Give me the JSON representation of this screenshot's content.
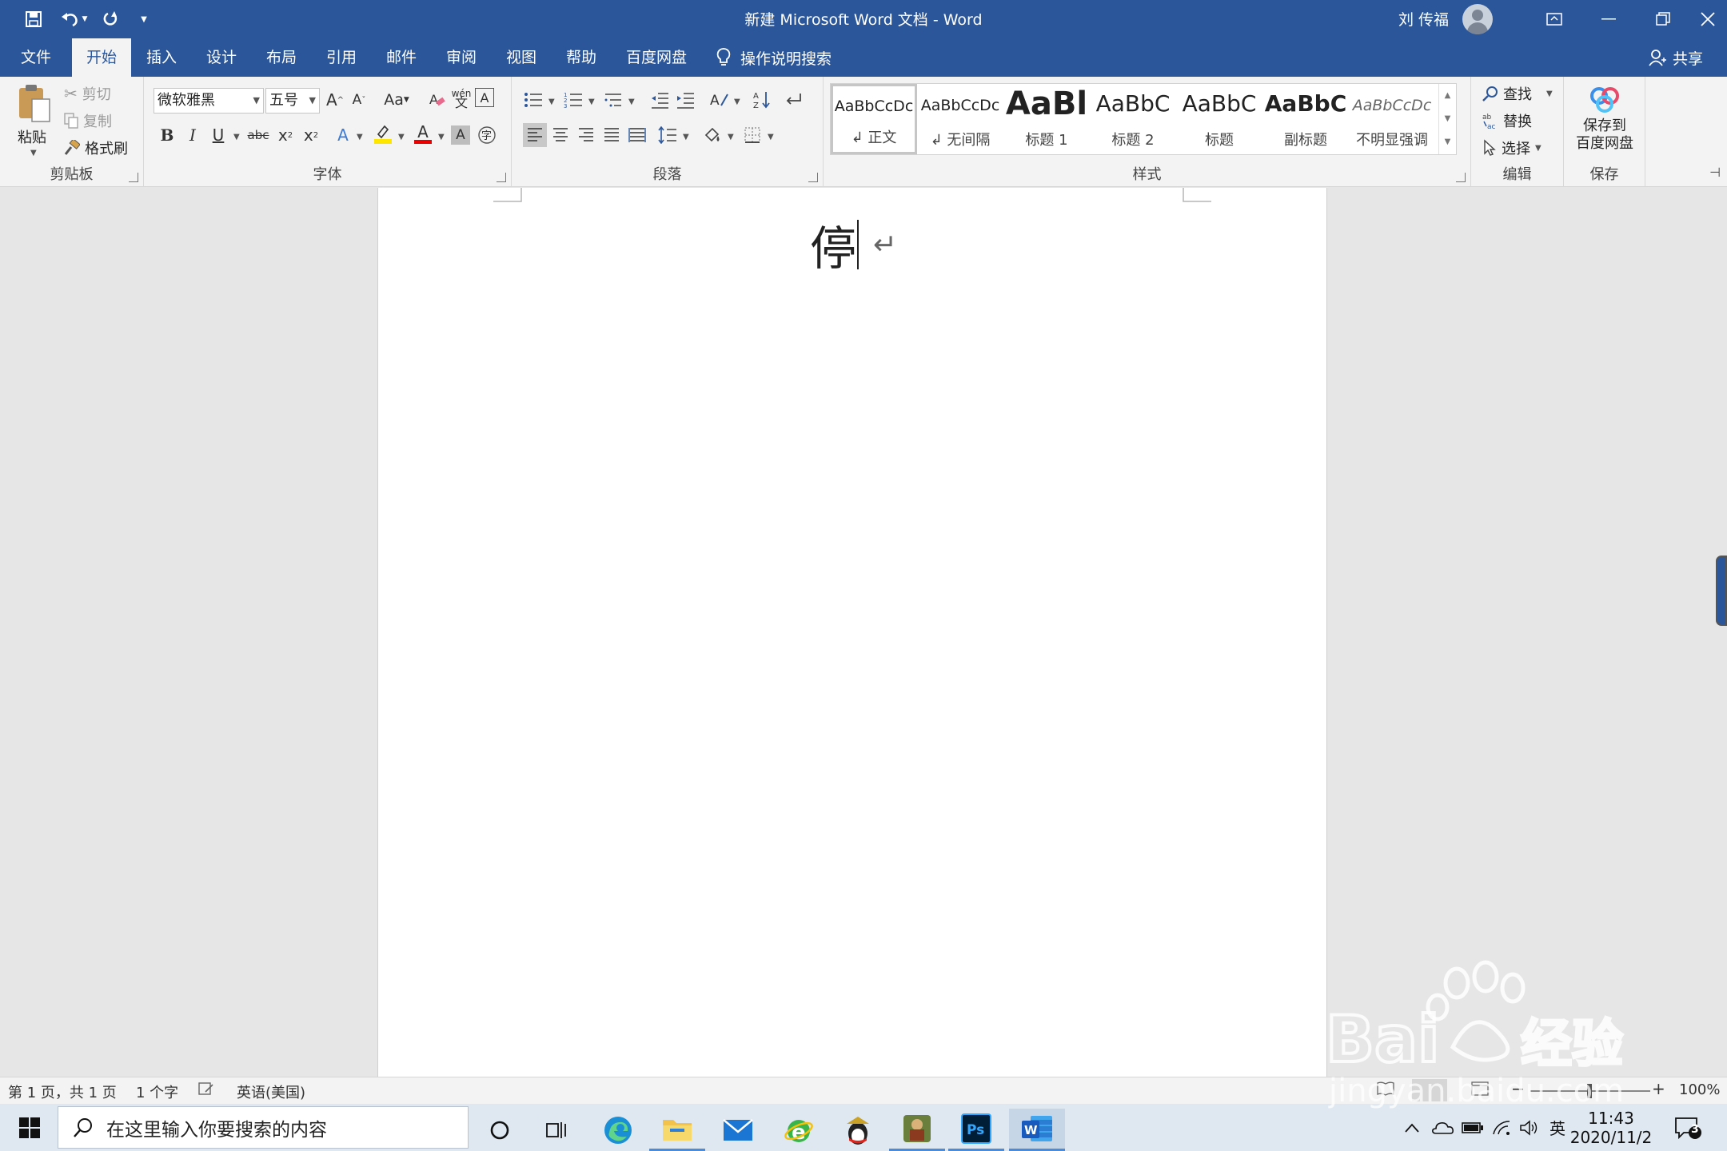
{
  "window": {
    "title": "新建 Microsoft Word 文档 - Word",
    "user_name": "刘 传福"
  },
  "tabs": [
    "文件",
    "开始",
    "插入",
    "设计",
    "布局",
    "引用",
    "邮件",
    "审阅",
    "视图",
    "帮助",
    "百度网盘"
  ],
  "active_tab": "开始",
  "tell_me": "操作说明搜索",
  "share_label": "共享",
  "clipboard": {
    "paste": "粘贴",
    "cut": "剪切",
    "copy": "复制",
    "format_painter": "格式刷",
    "label": "剪贴板"
  },
  "font": {
    "name": "微软雅黑",
    "size": "五号",
    "case": "Aa",
    "phonetic": "wén",
    "label": "字体"
  },
  "paragraph": {
    "label": "段落"
  },
  "styles": {
    "label": "样式",
    "items": [
      {
        "preview": "AaBbCcDc",
        "name": "↲ 正文"
      },
      {
        "preview": "AaBbCcDc",
        "name": "↲ 无间隔"
      },
      {
        "preview": "AaBl",
        "name": "标题 1"
      },
      {
        "preview": "AaBbC",
        "name": "标题 2"
      },
      {
        "preview": "AaBbC",
        "name": "标题"
      },
      {
        "preview": "AaBbC",
        "name": "副标题"
      },
      {
        "preview": "AaBbCcDc",
        "name": "不明显强调"
      }
    ]
  },
  "editing": {
    "find": "查找",
    "replace": "替换",
    "select": "选择",
    "label": "编辑"
  },
  "save": {
    "line1": "保存到",
    "line2": "百度网盘",
    "label": "保存"
  },
  "document": {
    "text": "停",
    "paragraph_mark": "↵"
  },
  "status": {
    "page": "第 1 页，共 1 页",
    "words": "1 个字",
    "language": "英语(美国)",
    "zoom": "100%"
  },
  "taskbar": {
    "search_placeholder": "在这里输入你要搜索的内容",
    "ime": "英",
    "time": "11:43",
    "date": "2020/11/2",
    "notifications": "3"
  },
  "colors": {
    "accent": "#2b579a",
    "ribbon_bg": "#f3f3f3",
    "canvas_bg": "#e6e6e6",
    "taskbar_bg": "#dfe8f1"
  }
}
